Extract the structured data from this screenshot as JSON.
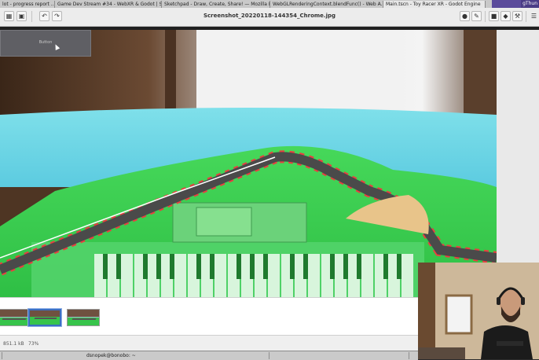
{
  "taskbar": {
    "tasks": [
      "lot - progress report ...<1>",
      "Game Dev Stream #34 - WebXR & Godot | Sno...",
      "Sketchpad - Draw, Create, Share! — Mozilla Fir...",
      "WebGLRenderingContext.blendFunc() - Web A...",
      "Main.tscn - Toy Racer XR - Godot Engine"
    ],
    "right_label": "gThun"
  },
  "viewer": {
    "title": "Screenshot_20220118-144354_Chrome.jpg",
    "icons_left": [
      "gallery-icon",
      "fullscreen-icon",
      "rotate-left-icon",
      "rotate-right-icon"
    ],
    "icons_right": [
      "location-icon",
      "edit-icon",
      "chat-icon",
      "tag-icon",
      "tools-icon",
      "menu-icon"
    ]
  },
  "overlay": {
    "button_label": "Button"
  },
  "status": {
    "file_size": "851.1 kB",
    "zoom": "73%"
  },
  "bottombar": {
    "user_host": "dsnopek@bonobo: ~"
  },
  "colors": {
    "grass": "#3ed054",
    "water": "#5fd6e6",
    "track": "#4a4a4a",
    "selection": "#3b6fc2"
  }
}
